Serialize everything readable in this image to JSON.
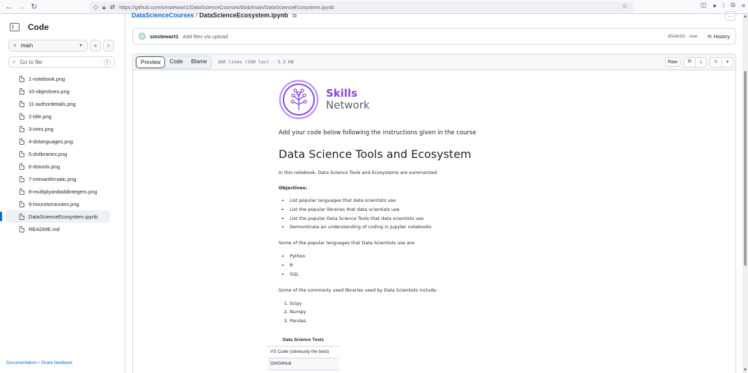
{
  "browser": {
    "url": "https://github.com/smstewart1/DataScienceCourses/blob/main/DataScienceEcosystem.ipynb"
  },
  "sidebar": {
    "title": "Code",
    "branch": "main",
    "goto_placeholder": "Go to file",
    "goto_kbd": "t",
    "files": [
      {
        "name": "1-notebook.png"
      },
      {
        "name": "10-objectives.png"
      },
      {
        "name": "11-authordetails.png"
      },
      {
        "name": "2-title.png"
      },
      {
        "name": "3-intro.png"
      },
      {
        "name": "4-dslanguages.png"
      },
      {
        "name": "5-dslibraries.png"
      },
      {
        "name": "6-dstools.png"
      },
      {
        "name": "7-introarithmatic.png"
      },
      {
        "name": "8-multiplyandaddintegers.png"
      },
      {
        "name": "9-hourstominutes.png"
      },
      {
        "name": "DataScienceEcosystem.ipynb",
        "active": true
      },
      {
        "name": "README.md"
      }
    ],
    "footer": {
      "docs": "Documentation",
      "sep": "•",
      "feedback": "Share feedback"
    }
  },
  "breadcrumb": {
    "repo": "DataScienceCourses",
    "sep": "/",
    "file": "DataScienceEcosystem.ipynb"
  },
  "commit": {
    "user": "smstewart1",
    "message": "Add files via upload",
    "meta": "d5e8c83 · now",
    "history_label": "History"
  },
  "file_header": {
    "tabs": [
      "Preview",
      "Code",
      "Blame"
    ],
    "active_tab": "Preview",
    "info": "160 lines (160 loc) · 3.3 KB",
    "raw_label": "Raw"
  },
  "notebook": {
    "logo_line1": "Skills",
    "logo_line2": "Network",
    "intro": "Add your code below following the instructions given in the course",
    "title": "Data Science Tools and Ecosystem",
    "summary": "In this notebook, Data Science Tools and Ecosystems are summarized",
    "objectives_label": "Objectives:",
    "objectives": [
      "List popular languages that data scientists use",
      "List the popular libraries that data scientists use",
      "List the popular Data Science Tools that data scientists use",
      "Demonstrate an understanding of coding in Jupyter notebooks"
    ],
    "languages_intro": "Some of the popular languages that Data Scientists use are:",
    "languages": [
      "Python",
      "R",
      "SQL"
    ],
    "libraries_intro": "Some of the commonly used libraries used by Data Scientists include:",
    "libraries": [
      "Scipy",
      "Numpy",
      "Pandas"
    ],
    "tools_header": "Data Science Tools",
    "tools": [
      "VS Code (obviously the best)",
      "Git/GitHub"
    ]
  },
  "colors": {
    "accent": "#0969da",
    "brand": "#8a45e6"
  }
}
